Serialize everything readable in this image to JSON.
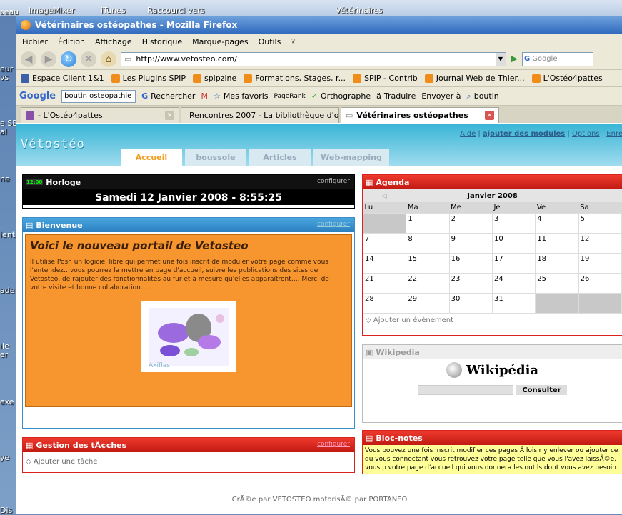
{
  "desktop": {
    "top_icons": [
      "ImageMixer",
      "iTunes",
      "Raccourci vers",
      "Vétérinaires"
    ],
    "left_labels": [
      "seau",
      "eur",
      "vs",
      "e SE",
      "al",
      "ne",
      "ient",
      "ade",
      "ile",
      "er",
      "exe",
      "ye",
      "Dis"
    ]
  },
  "browser": {
    "title": "Vétérinaires ostéopathes - Mozilla Firefox",
    "menu": [
      "Fichier",
      "Édition",
      "Affichage",
      "Historique",
      "Marque-pages",
      "Outils",
      "?"
    ],
    "url": "http://www.vetosteo.com/",
    "search_placeholder": "Google",
    "bookmarks": [
      "Espace Client 1&1",
      "Les Plugins SPIP",
      "spipzine",
      "Formations, Stages, r...",
      "SPIP - Contrib",
      "Journal Web de Thier...",
      "L'Ostéo4pattes"
    ],
    "google_bar": {
      "logo": "Google",
      "query": "boutin osteopathie",
      "search_btn": "Rechercher",
      "favorites": "Mes favoris",
      "pagerank": "PageRank",
      "spell": "Orthographe",
      "translate": "Traduire",
      "send": "Envoyer à",
      "highlight": "boutin"
    },
    "tabs": [
      "- L'Ostéo4pattes",
      "Rencontres 2007 - La bibliothèque d'o...",
      "Vétérinaires ostéopathes"
    ]
  },
  "page": {
    "logo": "Vétostéo",
    "top_links": {
      "aide": "Aide",
      "add": "ajouter des modules",
      "options": "Options",
      "save": "Enre"
    },
    "tabs": [
      "Accueil",
      "boussole",
      "Articles",
      "Web-mapping"
    ],
    "configure": "configurer",
    "horloge": {
      "title": "Horloge",
      "badge": "12:00",
      "time": "Samedi 12 Janvier 2008 - 8:55:25"
    },
    "bienvenue": {
      "title": "Bienvenue",
      "heading": "Voici le nouveau portail de Vetosteo",
      "text": "Il utilise Posh un logiciel libre qui permet une fois inscrit de moduler votre page comme vous l'entendez…vous pourrez la mettre en page d'accueil, suivre les publications des sites de Vetosteo, de rajouter des fonctionnalités au fur et à mesure qu'elles apparaîtront…. Merci de votre visite et bonne collaboration…..",
      "image_caption": "Axiflas"
    },
    "taches": {
      "title": "Gestion des tÃ¢ches",
      "add": "Ajouter une tâche"
    },
    "agenda": {
      "title": "Agenda",
      "month": "Janvier 2008",
      "days": [
        "Lu",
        "Ma",
        "Me",
        "Je",
        "Ve",
        "Sa"
      ],
      "weeks": [
        [
          "",
          "1",
          "2",
          "3",
          "4",
          "5"
        ],
        [
          "7",
          "8",
          "9",
          "10",
          "11",
          "12"
        ],
        [
          "14",
          "15",
          "16",
          "17",
          "18",
          "19"
        ],
        [
          "21",
          "22",
          "23",
          "24",
          "25",
          "26"
        ],
        [
          "28",
          "29",
          "30",
          "31",
          "",
          ""
        ]
      ],
      "add": "Ajouter un évènement"
    },
    "wikipedia": {
      "title": "Wikipedia",
      "logo": "Wikipédia",
      "button": "Consulter"
    },
    "blocnotes": {
      "title": "Bloc-notes",
      "text": "Vous pouvez une fois inscrit modifier ces pages Ã  loisir y enlever ou ajouter ce qu vous connectant vous retrouvez votre page telle que vous l'avez laissÃ©e, vous p votre page d'accueil qui vous donnera les outils dont vous avez besoin."
    },
    "footer": "CrÃ©e par VETOSTEO motorisÃ© par PORTANEO"
  },
  "colors": {
    "titlebar": "#2f68be",
    "header": "#3ab5d6",
    "bienvenue_bg": "#f7962f",
    "agenda": "#d9231c",
    "blocnotes": "#d9231c",
    "blocnotes_bg": "#ffff99"
  }
}
